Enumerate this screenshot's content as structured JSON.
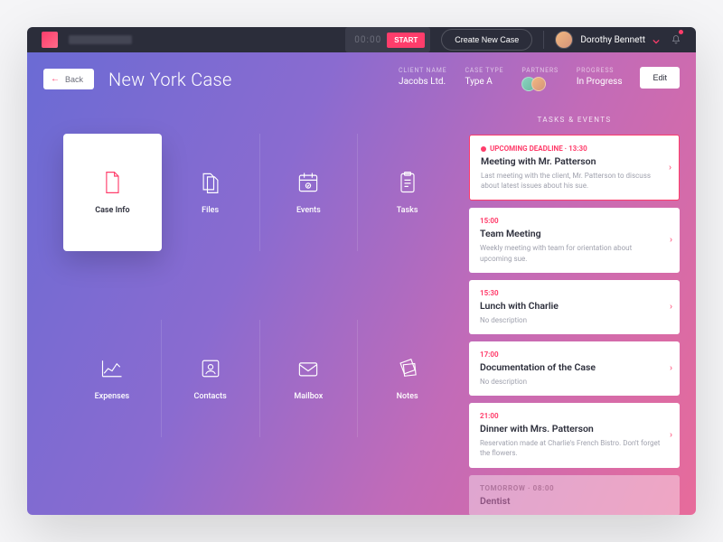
{
  "header": {
    "timer": "00:00",
    "start_label": "START",
    "create_case_label": "Create New Case",
    "user_name": "Dorothy Bennett"
  },
  "case": {
    "back_label": "Back",
    "title": "New York Case",
    "client_label": "CLIENT NAME",
    "client_value": "Jacobs Ltd.",
    "type_label": "CASE TYPE",
    "type_value": "Type A",
    "partners_label": "PARTNERS",
    "progress_label": "PROGRESS",
    "progress_value": "In Progress",
    "edit_label": "Edit"
  },
  "tiles": [
    {
      "label": "Case Info"
    },
    {
      "label": "Files"
    },
    {
      "label": "Events"
    },
    {
      "label": "Tasks"
    },
    {
      "label": "Expenses"
    },
    {
      "label": "Contacts"
    },
    {
      "label": "Mailbox"
    },
    {
      "label": "Notes"
    }
  ],
  "events": {
    "panel_title": "Tasks & Events",
    "items": [
      {
        "time_prefix": "UPCOMING DEADLINE · 13:30",
        "title": "Meeting with Mr. Patterson",
        "desc": "Last meeting with the client, Mr. Patterson to discuss about latest issues about his sue."
      },
      {
        "time_prefix": "15:00",
        "title": "Team Meeting",
        "desc": "Weekly meeting with team for orientation about upcoming sue."
      },
      {
        "time_prefix": "15:30",
        "title": "Lunch with Charlie",
        "desc": "No description"
      },
      {
        "time_prefix": "17:00",
        "title": "Documentation of the Case",
        "desc": "No description"
      },
      {
        "time_prefix": "21:00",
        "title": "Dinner with Mrs. Patterson",
        "desc": "Reservation made at Charlie's French Bistro. Don't forget the flowers."
      },
      {
        "time_prefix": "TOMORROW · 08:00",
        "title": "Dentist",
        "desc": ""
      }
    ]
  },
  "colors": {
    "accent": "#ff3d6b"
  }
}
